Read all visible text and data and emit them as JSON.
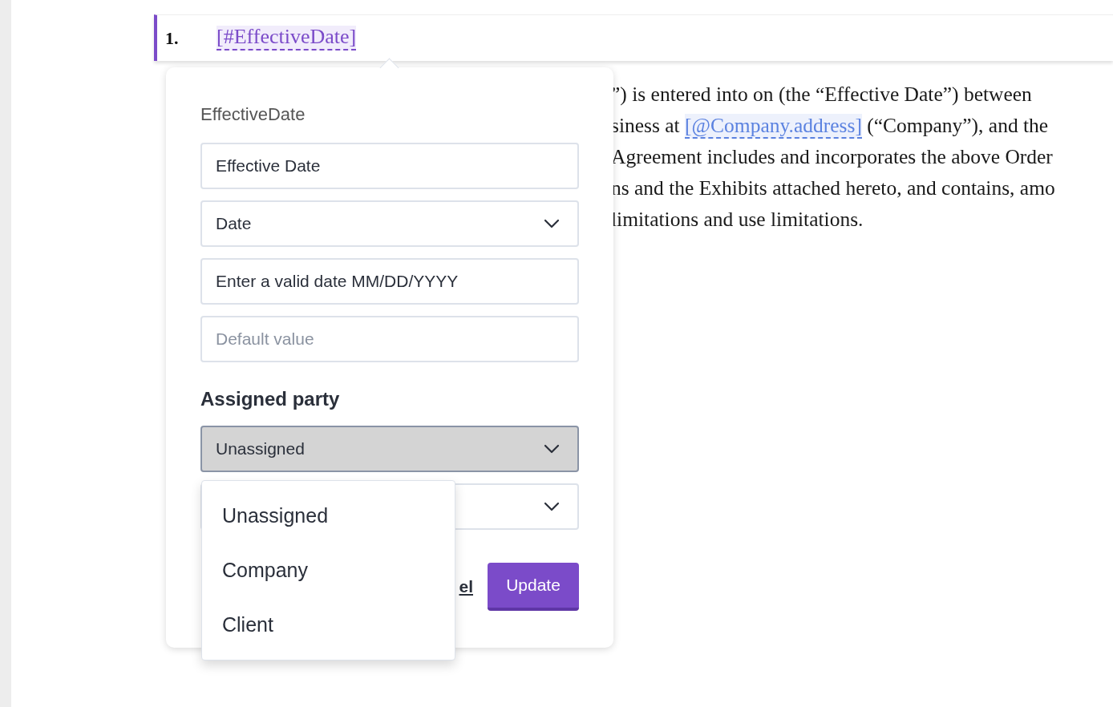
{
  "heading": {
    "number": "1.",
    "token": "[#EffectiveDate]"
  },
  "paragraph": {
    "lines": [
      [
        {
          "kind": "text",
          "text": "”) is entered into on (the “Effective Date”) between"
        }
      ],
      [
        {
          "kind": "text",
          "text": "siness at "
        },
        {
          "kind": "field",
          "text": "[@Company.address]"
        },
        {
          "kind": "text",
          "text": " (“Company”), and the"
        }
      ],
      [
        {
          "kind": "text",
          "text": "Agreement includes and incorporates the above Order"
        }
      ],
      [
        {
          "kind": "text",
          "text": "ns and the Exhibits attached hereto, and contains, amo"
        }
      ],
      [
        {
          "kind": "text",
          "text": "limitations and use limitations."
        }
      ]
    ]
  },
  "popover": {
    "title": "EffectiveDate",
    "fields": [
      {
        "kind": "input",
        "value": "Effective Date"
      },
      {
        "kind": "select",
        "value": "Date"
      },
      {
        "kind": "input",
        "value": "Enter a valid date MM/DD/YYYY"
      },
      {
        "kind": "input",
        "placeholder": "Default value"
      }
    ],
    "section_title": "Assigned party",
    "party_select": {
      "value": "Unassigned",
      "open": true
    },
    "cancel_link": "el",
    "update_button": "Update"
  },
  "dropdown": {
    "options": [
      {
        "label": "Unassigned",
        "selected": false
      },
      {
        "label": "Company",
        "selected": false
      },
      {
        "label": "Client",
        "selected": false
      }
    ]
  }
}
